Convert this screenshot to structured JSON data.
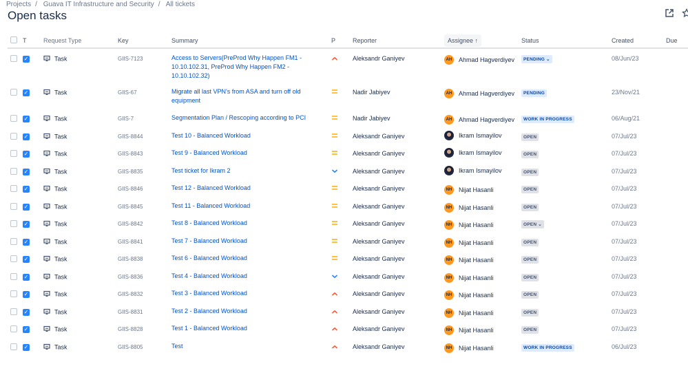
{
  "breadcrumb": [
    "Projects",
    "Guava IT Infrastructure and Security",
    "All tickets"
  ],
  "title": "Open tasks",
  "columns": {
    "t": "T",
    "request_type": "Request Type",
    "key": "Key",
    "summary": "Summary",
    "p": "P",
    "reporter": "Reporter",
    "assignee": "Assignee",
    "sort_arrow": "↑",
    "status": "Status",
    "created": "Created",
    "due": "Due"
  },
  "colors": {
    "link": "#0052cc",
    "high": "#ff5630",
    "medium": "#ffab00",
    "low": "#2684ff",
    "avatar": "#ff991f"
  },
  "rows": [
    {
      "type": "Task",
      "key": "GIIS-7123",
      "summary": "Access to Servers(PreProd Why Happen FM1 - 10.10.102.31, PreProd Why Happen FM2 - 10.10.102.32)",
      "priority": "high",
      "reporter": "Aleksandr Ganiyev",
      "assignee": "Ahmad Hagverdiyev",
      "initials": "AH",
      "status": "PENDING",
      "status_dropdown": true,
      "created": "08/Jun/23"
    },
    {
      "type": "Task",
      "key": "GIIS-67",
      "summary": "Migrate all last VPN's from ASA and turn off old equipment",
      "priority": "medium",
      "reporter": "Nadir Jabiyev",
      "assignee": "Ahmad Hagverdiyev",
      "initials": "AH",
      "status": "PENDING",
      "created": "23/Nov/21"
    },
    {
      "type": "Task",
      "key": "GIIS-7",
      "summary": "Segmentation Plan / Rescoping according to PCI",
      "priority": "medium",
      "reporter": "Nadir Jabiyev",
      "assignee": "Ahmad Hagverdiyev",
      "initials": "AH",
      "status": "WORK IN PROGRESS",
      "created": "06/Aug/21"
    },
    {
      "type": "Task",
      "key": "GIIS-8844",
      "summary": "Test 10 - Balanced Workload",
      "priority": "medium",
      "reporter": "Aleksandr Ganiyev",
      "assignee": "Ikram Ismayilov",
      "initials": "",
      "status": "OPEN",
      "created": "07/Jul/23"
    },
    {
      "type": "Task",
      "key": "GIIS-8843",
      "summary": "Test 9 - Balanced Workload",
      "priority": "medium",
      "reporter": "Aleksandr Ganiyev",
      "assignee": "Ikram Ismayilov",
      "initials": "",
      "status": "OPEN",
      "created": "07/Jul/23"
    },
    {
      "type": "Task",
      "key": "GIIS-8835",
      "summary": "Test ticket for Ikram 2",
      "priority": "low",
      "reporter": "Aleksandr Ganiyev",
      "assignee": "Ikram Ismayilov",
      "initials": "",
      "status": "OPEN",
      "created": "07/Jul/23"
    },
    {
      "type": "Task",
      "key": "GIIS-8846",
      "summary": "Test 12 - Balanced Workload",
      "priority": "medium",
      "reporter": "Aleksandr Ganiyev",
      "assignee": "Nijat Hasanli",
      "initials": "NH",
      "status": "OPEN",
      "created": "07/Jul/23"
    },
    {
      "type": "Task",
      "key": "GIIS-8845",
      "summary": "Test 11 - Balanced Workload",
      "priority": "medium",
      "reporter": "Aleksandr Ganiyev",
      "assignee": "Nijat Hasanli",
      "initials": "NH",
      "status": "OPEN",
      "created": "07/Jul/23"
    },
    {
      "type": "Task",
      "key": "GIIS-8842",
      "summary": "Test 8 - Balanced Workload",
      "priority": "medium",
      "reporter": "Aleksandr Ganiyev",
      "assignee": "Nijat Hasanli",
      "initials": "NH",
      "status": "OPEN",
      "status_dropdown": true,
      "created": "07/Jul/23"
    },
    {
      "type": "Task",
      "key": "GIIS-8841",
      "summary": "Test 7 - Balanced Workload",
      "priority": "medium",
      "reporter": "Aleksandr Ganiyev",
      "assignee": "Nijat Hasanli",
      "initials": "NH",
      "status": "OPEN",
      "created": "07/Jul/23"
    },
    {
      "type": "Task",
      "key": "GIIS-8838",
      "summary": "Test 6 - Balanced Workload",
      "priority": "medium",
      "reporter": "Aleksandr Ganiyev",
      "assignee": "Nijat Hasanli",
      "initials": "NH",
      "status": "OPEN",
      "created": "07/Jul/23"
    },
    {
      "type": "Task",
      "key": "GIIS-8836",
      "summary": "Test 4 - Balanced Workload",
      "priority": "low",
      "reporter": "Aleksandr Ganiyev",
      "assignee": "Nijat Hasanli",
      "initials": "NH",
      "status": "OPEN",
      "created": "07/Jul/23"
    },
    {
      "type": "Task",
      "key": "GIIS-8832",
      "summary": "Test 3 - Balanced Workload",
      "priority": "high",
      "reporter": "Aleksandr Ganiyev",
      "assignee": "Nijat Hasanli",
      "initials": "NH",
      "status": "OPEN",
      "created": "07/Jul/23"
    },
    {
      "type": "Task",
      "key": "GIIS-8831",
      "summary": "Test 2 - Balanced Workload",
      "priority": "high",
      "reporter": "Aleksandr Ganiyev",
      "assignee": "Nijat Hasanli",
      "initials": "NH",
      "status": "OPEN",
      "created": "07/Jul/23"
    },
    {
      "type": "Task",
      "key": "GIIS-8828",
      "summary": "Test 1 - Balanced Workload",
      "priority": "high",
      "reporter": "Aleksandr Ganiyev",
      "assignee": "Nijat Hasanli",
      "initials": "NH",
      "status": "OPEN",
      "created": "07/Jul/23"
    },
    {
      "type": "Task",
      "key": "GIIS-8805",
      "summary": "Test",
      "priority": "high",
      "reporter": "Aleksandr Ganiyev",
      "assignee": "Nijat Hasanli",
      "initials": "NH",
      "status": "WORK IN PROGRESS",
      "created": "06/Jul/23"
    }
  ]
}
